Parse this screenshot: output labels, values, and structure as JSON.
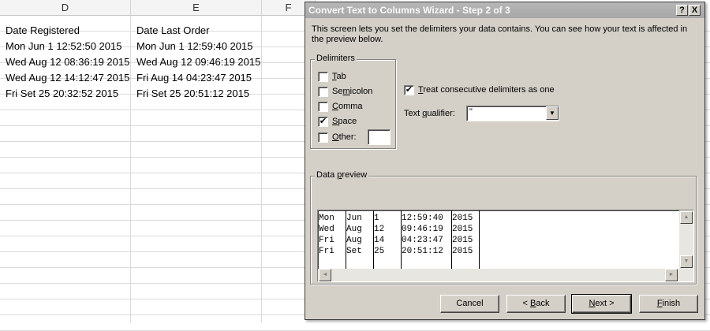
{
  "sheet": {
    "columns": [
      {
        "label": "D"
      },
      {
        "label": "E"
      },
      {
        "label": "F"
      }
    ],
    "rows": [
      [
        "Date Registered",
        "Date Last Order"
      ],
      [
        "Mon Jun  1 12:52:50 2015",
        "Mon Jun  1 12:59:40 2015"
      ],
      [
        "Wed Aug  12 08:36:19 2015",
        "Wed Aug  12 09:46:19 2015"
      ],
      [
        "Wed Aug  12 14:12:47 2015",
        "Fri Aug  14 04:23:47 2015"
      ],
      [
        "Fri Set  25 20:32:52 2015",
        "Fri Set  25 20:51:12 2015"
      ]
    ]
  },
  "dialog": {
    "title": "Convert Text to Columns Wizard - Step 2 of 3",
    "help_glyph": "?",
    "close_glyph": "X",
    "description": "This screen lets you set the delimiters your data contains.  You can see how your text is affected in the preview below.",
    "delimiters": {
      "legend": "Delimiters",
      "items": [
        {
          "pre": "",
          "key": "T",
          "post": "ab",
          "checked": false
        },
        {
          "pre": "Se",
          "key": "m",
          "post": "icolon",
          "checked": false
        },
        {
          "pre": "",
          "key": "C",
          "post": "omma",
          "checked": false
        },
        {
          "pre": "",
          "key": "S",
          "post": "pace",
          "checked": true
        },
        {
          "pre": "",
          "key": "O",
          "post": "ther:",
          "checked": false
        }
      ],
      "other_value": ""
    },
    "consecutive": {
      "pre": "",
      "key": "T",
      "post": "reat consecutive delimiters as one",
      "checked": true
    },
    "qualifier": {
      "pre": "Text ",
      "key": "q",
      "post": "ualifier:",
      "value": "\""
    },
    "preview": {
      "legend_pre": "Data ",
      "legend_key": "p",
      "legend_post": "review",
      "rows": [
        [
          "Mon",
          "Jun",
          "1",
          "12:59:40",
          "2015"
        ],
        [
          "Wed",
          "Aug",
          "12",
          "09:46:19",
          "2015"
        ],
        [
          "Fri",
          "Aug",
          "14",
          "04:23:47",
          "2015"
        ],
        [
          "Fri",
          "Set",
          "25",
          "20:51:12",
          "2015"
        ]
      ]
    },
    "buttons": {
      "cancel": "Cancel",
      "back_pre": "< ",
      "back_key": "B",
      "back_post": "ack",
      "next_key": "N",
      "next_post": "ext >",
      "finish_key": "F",
      "finish_post": "inish"
    },
    "check_glyph": "✔",
    "arrow_down": "▼",
    "arrow_up": "▲",
    "arrow_left": "◄",
    "arrow_right": "►"
  }
}
